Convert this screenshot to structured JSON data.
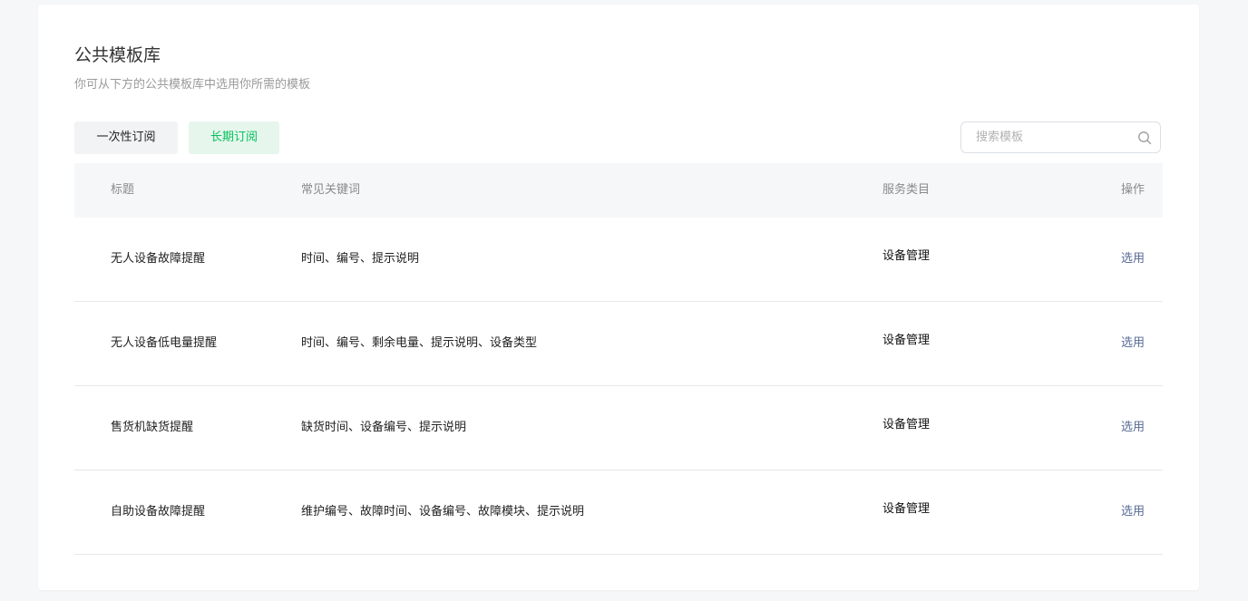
{
  "header": {
    "title": "公共模板库",
    "subtitle": "你可从下方的公共模板库中选用你所需的模板"
  },
  "tabs": [
    {
      "label": "一次性订阅",
      "active": false
    },
    {
      "label": "长期订阅",
      "active": true
    }
  ],
  "search": {
    "placeholder": "搜索模板",
    "value": "",
    "icon": "search-icon"
  },
  "table": {
    "columns": [
      "标题",
      "常见关键词",
      "服务类目",
      "操作"
    ],
    "rows": [
      {
        "title": "无人设备故障提醒",
        "keywords": "时间、编号、提示说明",
        "category": "设备管理",
        "action": "选用"
      },
      {
        "title": "无人设备低电量提醒",
        "keywords": "时间、编号、剩余电量、提示说明、设备类型",
        "category": "设备管理",
        "action": "选用"
      },
      {
        "title": "售货机缺货提醒",
        "keywords": "缺货时间、设备编号、提示说明",
        "category": "设备管理",
        "action": "选用"
      },
      {
        "title": "自助设备故障提醒",
        "keywords": "维护编号、故障时间、设备编号、故障模块、提示说明",
        "category": "设备管理",
        "action": "选用"
      }
    ]
  },
  "colors": {
    "accent": "#07c160",
    "accent_bg": "#e6f6ec",
    "link": "#576b95",
    "header_bg": "#f6f7f9"
  }
}
